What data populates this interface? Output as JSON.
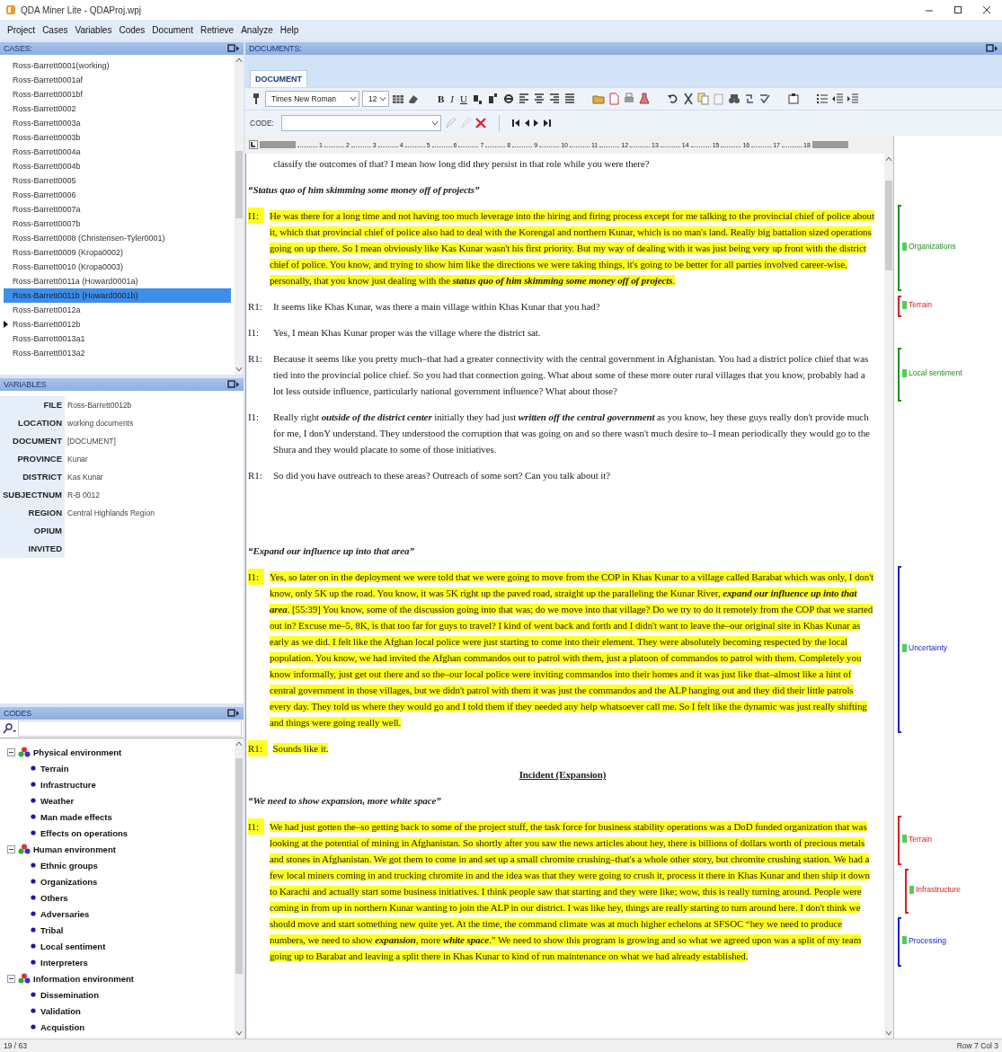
{
  "window": {
    "title": "QDA Miner Lite - QDAProj.wpj"
  },
  "menu": [
    "Project",
    "Cases",
    "Variables",
    "Codes",
    "Document",
    "Retrieve",
    "Analyze",
    "Help"
  ],
  "cases": {
    "title": "CASES:",
    "items": [
      {
        "label": "Ross-Barrett0001(working)",
        "selected": false,
        "current": false
      },
      {
        "label": "Ross-Barrett0001af",
        "selected": false,
        "current": false
      },
      {
        "label": "Ross-Barrett0001bf",
        "selected": false,
        "current": false
      },
      {
        "label": "Ross-Barrett0002",
        "selected": false,
        "current": false
      },
      {
        "label": "Ross-Barrett0003a",
        "selected": false,
        "current": false
      },
      {
        "label": "Ross-Barrett0003b",
        "selected": false,
        "current": false
      },
      {
        "label": "Ross-Barrett0004a",
        "selected": false,
        "current": false
      },
      {
        "label": "Ross-Barrett0004b",
        "selected": false,
        "current": false
      },
      {
        "label": "Ross-Barrett0005",
        "selected": false,
        "current": false
      },
      {
        "label": "Ross-Barrett0006",
        "selected": false,
        "current": false
      },
      {
        "label": "Ross-Barrett0007a",
        "selected": false,
        "current": false
      },
      {
        "label": "Ross-Barrett0007b",
        "selected": false,
        "current": false
      },
      {
        "label": "Ross-Barrett0008 (Christensen-Tyler0001)",
        "selected": false,
        "current": false
      },
      {
        "label": "Ross-Barrett0009 (Kropa0002)",
        "selected": false,
        "current": false
      },
      {
        "label": "Ross-Barrett0010 (Kropa0003)",
        "selected": false,
        "current": false
      },
      {
        "label": "Ross-Barrett0011a (Howard0001a)",
        "selected": false,
        "current": false
      },
      {
        "label": "Ross-Barrett0011b (Howard0001b)",
        "selected": true,
        "current": false
      },
      {
        "label": "Ross-Barrett0012a",
        "selected": false,
        "current": false
      },
      {
        "label": "Ross-Barrett0012b",
        "selected": false,
        "current": true
      },
      {
        "label": "Ross-Barrett0013a1",
        "selected": false,
        "current": false
      },
      {
        "label": "Ross-Barrett0013a2",
        "selected": false,
        "current": false
      }
    ]
  },
  "variables": {
    "title": "VARIABLES",
    "rows": [
      {
        "name": "FILE",
        "value": "Ross-Barrett0012b"
      },
      {
        "name": "LOCATION",
        "value": "working documents"
      },
      {
        "name": "DOCUMENT",
        "value": "[DOCUMENT]"
      },
      {
        "name": "PROVINCE",
        "value": "Kunar"
      },
      {
        "name": "DISTRICT",
        "value": "Kas Kunar"
      },
      {
        "name": "SUBJECTNUM",
        "value": "R-B 0012"
      },
      {
        "name": "REGION",
        "value": "Central Highlands Region"
      },
      {
        "name": "OPIUM"
      },
      {
        "name": "INVITED"
      }
    ]
  },
  "codes": {
    "title": "CODES",
    "tree": [
      {
        "label": "Physical environment",
        "expanded": true,
        "children": [
          {
            "label": "Terrain"
          },
          {
            "label": "Infrastructure"
          },
          {
            "label": "Weather"
          },
          {
            "label": "Man made effects"
          },
          {
            "label": "Effects on operations"
          }
        ]
      },
      {
        "label": "Human environment",
        "expanded": true,
        "children": [
          {
            "label": "Ethnic groups"
          },
          {
            "label": "Organizations"
          },
          {
            "label": "Others"
          },
          {
            "label": "Adversaries"
          },
          {
            "label": "Tribal"
          },
          {
            "label": "Local sentiment"
          },
          {
            "label": "Interpreters"
          }
        ]
      },
      {
        "label": "Information environment",
        "expanded": true,
        "children": [
          {
            "label": "Dissemination"
          },
          {
            "label": "Validation"
          },
          {
            "label": "Acquistion"
          }
        ]
      }
    ]
  },
  "documents": {
    "title": "DOCUMENTS:",
    "tabs": [
      {
        "label": "DOCUMENT",
        "selected": true
      }
    ],
    "toolbar": {
      "font": "Times New Roman",
      "size": "12",
      "text_buttons": [
        "B",
        "I",
        "U"
      ]
    },
    "code_bar": {
      "label": "CODE:"
    },
    "ruler": [
      "1",
      "2",
      "3",
      "4",
      "5",
      "6",
      "7",
      "8",
      "9",
      "10",
      "11",
      "12",
      "13",
      "14",
      "15",
      "16",
      "17",
      "18"
    ],
    "paragraphs": [
      {
        "kind": "continuation",
        "text": "classify the outcomes of that? I mean how long did they persist in that role while you were there?"
      },
      {
        "kind": "heading",
        "text": "“Status quo of him skimming some money off of projects”"
      },
      {
        "kind": "speech",
        "speaker": "I1:",
        "highlighted": true,
        "text": "He was there for a long time and not having too much leverage into the hiring and firing process except for me talking to the provincial chief of police about it, which that provincial chief of police also had to deal with the Korengal and northern Kunar, which is no man's land. Really big battalion sized operations going on up there. So I mean obviously like Kas Kunar wasn't his first priority. But my way of dealing with it was just being very up front with the district chief of police. You know, and trying to show him like the directions we were taking things, it's going to be better for all parties involved career-wise, personally, that you know just dealing with the **status quo of him skimming some money off of projects**.",
        "codes": [
          {
            "label": "Organizations",
            "color": "#228b22"
          }
        ]
      },
      {
        "kind": "speech",
        "speaker": "R1:",
        "highlighted": false,
        "text": "It seems like Khas Kunar, was there a main village within Khas Kunar that you had?",
        "codes": [
          {
            "label": "Terrain",
            "color": "#d42020"
          }
        ]
      },
      {
        "kind": "speech",
        "speaker": "I1:",
        "highlighted": false,
        "text": "Yes, I mean Khas Kunar proper was the village where the district sat."
      },
      {
        "kind": "speech",
        "speaker": "R1:",
        "highlighted": false,
        "text": "Because it seems like you pretty much–that had a greater connectivity with the central government in Afghanistan. You had a district police chief that was tied into the provincial police chief. So you had that connection going. What about some of these more outer rural villages that you know, probably had a lot less outside influence, particularly national government influence? What about those?",
        "codes": [
          {
            "label": "Local sentiment",
            "color": "#228b22"
          }
        ]
      },
      {
        "kind": "speech",
        "speaker": "I1:",
        "highlighted": false,
        "text": "Really right **outside of the district center** initially they had just **written off the central government** as you know, hey these guys really don't provide much for me, I donY understand. They understood the corruption that was going on and so there wasn't much desire to–I mean periodically they would go to the Shura and they would placate to some of those initiatives."
      },
      {
        "kind": "speech",
        "speaker": "R1:",
        "highlighted": false,
        "text": "So did you have outreach to these areas? Outreach of some sort? Can you talk about it?"
      },
      {
        "kind": "blank"
      },
      {
        "kind": "heading",
        "text": "“Expand our influence up into that area”"
      },
      {
        "kind": "speech",
        "speaker": "I1:",
        "highlighted": true,
        "text": "Yes, so later on in the deployment we were told that we were going to move from the COP in Khas Kunar to a village called Barabat which was only, I don't know, only 5K up the road. You know, it was 5K right up the paved road, straight up the paralleling the Kunar River, **expand our influence up into that area**. [55:39] You know, some of the discussion going into that was; do we move into that village? Do we try to do it remotely from the COP that we started out in? Excuse me–5, 8K, is that too far for guys to travel? I kind of went back and forth and I didn't want to leave the–our original site in Khas Kunar as early as we did. I felt like the Afghan local police were just starting to come into their element. They were absolutely becoming respected by the local population. You know, we had invited the Afghan commandos out to patrol with them, just a platoon of commandos to patrol with them. Completely you know informally, just get out there and so the–our local police were inviting commandos into their homes and it was just like that–almost like a hint of central government in those villages, but we didn't patrol with them it was just the commandos and the ALP hanging out and they did their little patrols every day. They told us where they would go and I told them if they needed any help whatsoever call me. So I felt like the dynamic was just really shifting and things were going really well.",
        "codes": [
          {
            "label": "Uncertainty",
            "color": "#2222c8"
          }
        ]
      },
      {
        "kind": "speech",
        "speaker": "R1:",
        "highlighted": true,
        "text": "Sounds like it."
      },
      {
        "kind": "title",
        "text": "Incident (Expansion)"
      },
      {
        "kind": "heading",
        "text": "“We need to show expansion, more white space”"
      },
      {
        "kind": "speech",
        "speaker": "I1:",
        "highlighted": true,
        "text": "We had just gotten the–so getting back to some of the project stuff, the task force for business stability operations was a DoD funded organization that was looking at the potential of mining in Afghanistan. So shortly after you saw the news articles about hey, there is billions of dollars worth of precious metals and stones in Afghanistan. We got them to come in and set up a small chromite crushing–that's a whole other story, but chromite crushing station. We had a few local miners coming in and trucking chromite in and the idea was that they were going to crush it, process it there in Khas Kunar and then ship it down to Karachi and actually start some business initiatives. I think people saw that starting and they were like; wow, this is really turning around. People were coming in from up in northern Kunar wanting to join the ALP in our district. I was like hey, things are really starting to turn around here. I don't think we should move and start something new quite yet. At the time, the command climate was at much higher echelons at SFSOC “hey we need to produce numbers, we need to show **expansion**, more **white space**.” We need to show this program is growing and so what we agreed upon was a split of my team going up to Barabat and leaving a split there in Khas Kunar to kind of run maintenance on what we had already established.",
        "codes": [
          {
            "label": "Terrain",
            "color": "#d42020"
          },
          {
            "label": "Infrastructure",
            "color": "#d42020"
          },
          {
            "label": "Processing",
            "color": "#2222c8"
          }
        ]
      }
    ]
  },
  "status_bar": {
    "left": "19 / 63",
    "right": "Row 7 Col 3"
  }
}
